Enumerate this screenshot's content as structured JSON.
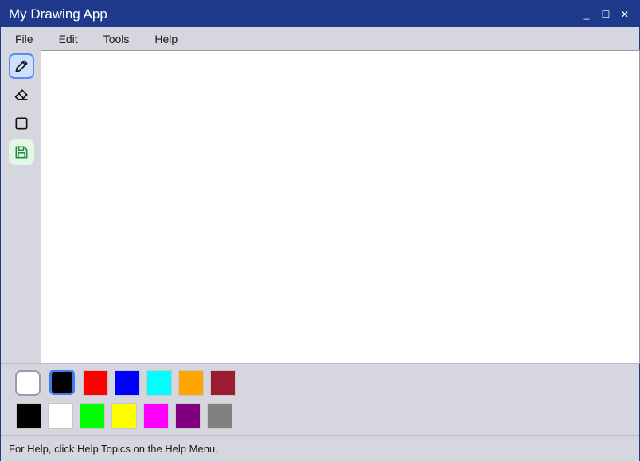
{
  "window": {
    "title": "My Drawing App",
    "controls": {
      "minimize": "_",
      "maximize": "☐",
      "close": "✕"
    }
  },
  "menubar": {
    "items": [
      {
        "label": "File"
      },
      {
        "label": "Edit"
      },
      {
        "label": "Tools"
      },
      {
        "label": "Help"
      }
    ]
  },
  "toolbar": {
    "tools": [
      {
        "name": "pencil-icon",
        "active": true
      },
      {
        "name": "eraser-icon",
        "active": false
      },
      {
        "name": "rectangle-icon",
        "active": false
      },
      {
        "name": "save-icon",
        "active": false
      }
    ]
  },
  "palette": {
    "selected_background": "#ffffff",
    "selected_foreground": "#000000",
    "row1": [
      "#ff0000",
      "#0000ff",
      "#00ffff",
      "#ffa500",
      "#9b1b30"
    ],
    "row2": [
      "#000000",
      "#ffffff",
      "#00ff00",
      "#ffff00",
      "#ff00ff",
      "#800080",
      "#808080"
    ]
  },
  "statusbar": {
    "text": "For Help, click Help Topics on the Help Menu."
  }
}
